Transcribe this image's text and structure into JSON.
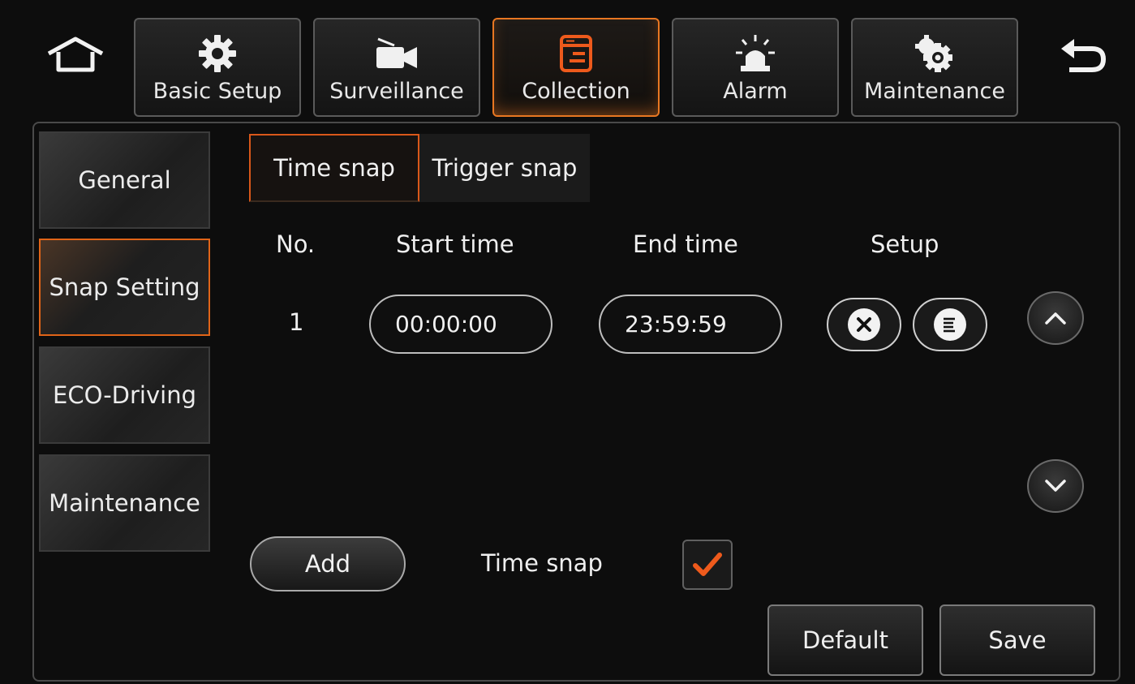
{
  "topbar": {
    "tabs": [
      {
        "label": "Basic Setup",
        "icon": "gear-icon"
      },
      {
        "label": "Surveillance",
        "icon": "camera-icon"
      },
      {
        "label": "Collection",
        "icon": "document-icon"
      },
      {
        "label": "Alarm",
        "icon": "siren-icon"
      },
      {
        "label": "Maintenance",
        "icon": "gears-icon"
      }
    ],
    "active_tab": "Collection",
    "home_icon": "home-icon",
    "back_icon": "back-arrow-icon"
  },
  "sidebar": {
    "items": [
      {
        "label": "General"
      },
      {
        "label": "Snap Setting"
      },
      {
        "label": "ECO-Driving"
      },
      {
        "label": "Maintenance"
      }
    ],
    "active": "Snap Setting"
  },
  "subtabs": {
    "items": [
      {
        "label": "Time snap"
      },
      {
        "label": "Trigger snap"
      }
    ],
    "active": "Time snap"
  },
  "table": {
    "headers": {
      "no": "No.",
      "start": "Start time",
      "end": "End time",
      "setup": "Setup"
    },
    "rows": [
      {
        "no": "1",
        "start": "00:00:00",
        "end": "23:59:59"
      }
    ]
  },
  "footer": {
    "add_label": "Add",
    "checkbox_label": "Time snap",
    "checkbox_checked": true,
    "default_label": "Default",
    "save_label": "Save"
  },
  "colors": {
    "accent": "#e87722",
    "checkmark": "#ee5a1c",
    "background": "#0d0d0d"
  }
}
